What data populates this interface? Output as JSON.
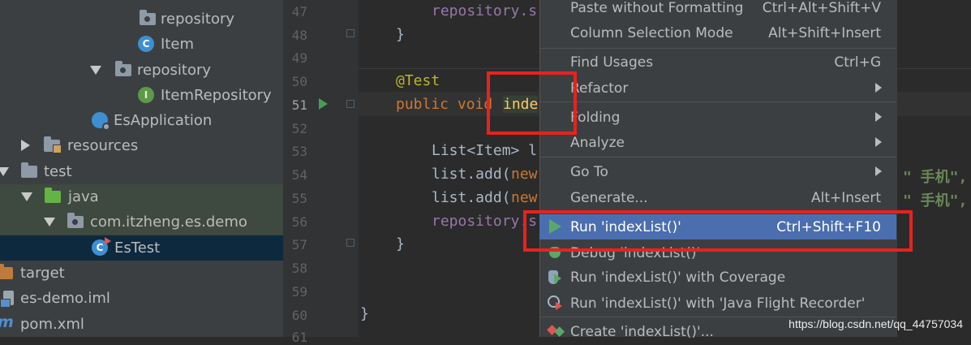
{
  "tree": {
    "items": [
      {
        "label": "repository",
        "kind": "package"
      },
      {
        "label": "Item",
        "kind": "class"
      },
      {
        "label": "repository",
        "kind": "package"
      },
      {
        "label": "ItemRepository",
        "kind": "interface"
      },
      {
        "label": "EsApplication",
        "kind": "spring-app"
      },
      {
        "label": "resources",
        "kind": "resources-folder"
      },
      {
        "label": "test",
        "kind": "folder"
      },
      {
        "label": "java",
        "kind": "test-source-root"
      },
      {
        "label": "com.itzheng.es.demo",
        "kind": "package"
      },
      {
        "label": "EsTest",
        "kind": "test-class"
      },
      {
        "label": "target",
        "kind": "excluded-folder"
      },
      {
        "label": "es-demo.iml",
        "kind": "module-file"
      },
      {
        "label": "pom.xml",
        "kind": "maven-file"
      }
    ]
  },
  "gutter": {
    "line_numbers": [
      "47",
      "48",
      "49",
      "50",
      "51",
      "52",
      "53",
      "54",
      "55",
      "56",
      "57",
      "58",
      "59",
      "60",
      "61"
    ]
  },
  "code": {
    "l47": "repository.s",
    "l48": "}",
    "l50": "@Test",
    "l51_kw": "public void ",
    "l51_name": "inde",
    "l53_a": "List<Item> l",
    "l54_a": "list.add(",
    "l54_b": "new",
    "l55_a": "list.add(",
    "l55_b": "new",
    "l56": "repository.s",
    "l57": "}",
    "l60": "}",
    "l54_tail": "\" 手机\",",
    "l55_tail": "\" 手机\","
  },
  "menu": {
    "items": [
      {
        "label": "Paste without Formatting",
        "shortcut": "Ctrl+Alt+Shift+V"
      },
      {
        "label": "Column Selection Mode",
        "shortcut": "Alt+Shift+Insert"
      },
      {
        "label": "Find Usages",
        "shortcut": "Ctrl+G"
      },
      {
        "label": "Refactor",
        "shortcut": ""
      },
      {
        "label": "Folding",
        "shortcut": ""
      },
      {
        "label": "Analyze",
        "shortcut": ""
      },
      {
        "label": "Go To",
        "shortcut": ""
      },
      {
        "label": "Generate...",
        "shortcut": "Alt+Insert"
      },
      {
        "label": "Run 'indexList()'",
        "shortcut": "Ctrl+Shift+F10"
      },
      {
        "label": "Debug 'indexList()'",
        "shortcut": ""
      },
      {
        "label": "Run 'indexList()' with Coverage",
        "shortcut": ""
      },
      {
        "label": "Run 'indexList()' with 'Java Flight Recorder'",
        "shortcut": ""
      },
      {
        "label": "Create 'indexList()'...",
        "shortcut": ""
      }
    ]
  },
  "watermark": "https://blog.csdn.net/qq_44757034",
  "colors": {
    "highlight_box": "#e8221f",
    "menu_selected": "#4b6eaf",
    "run_icon": "#59a869"
  }
}
